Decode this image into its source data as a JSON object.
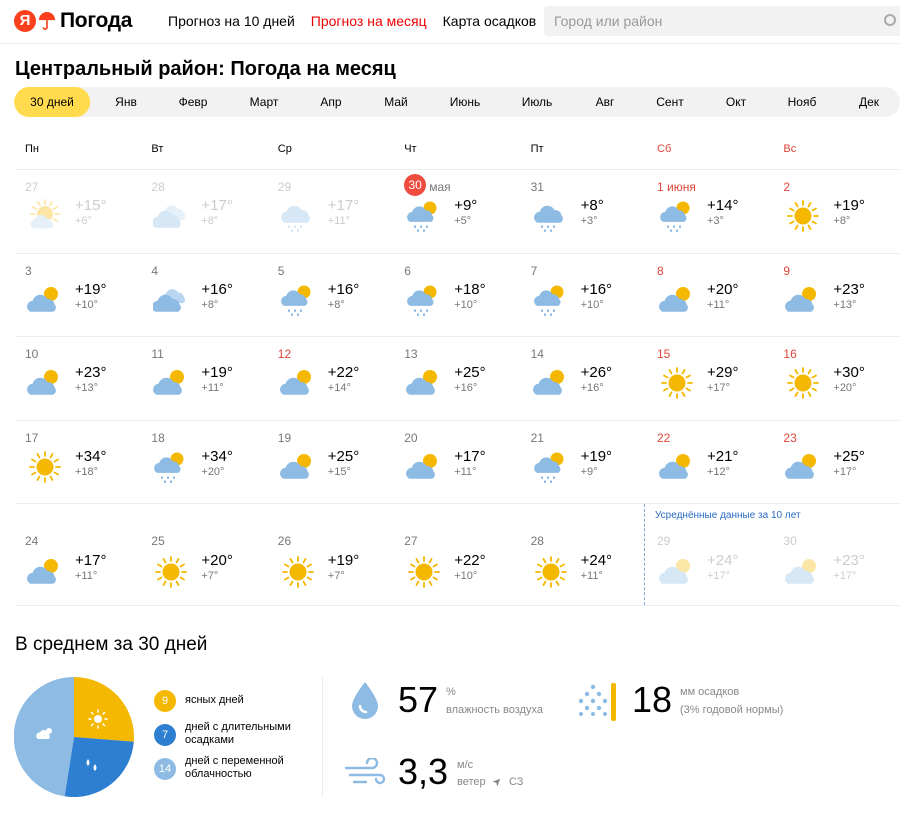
{
  "header": {
    "logo_letter": "Я",
    "logo_text": "Погода",
    "nav": [
      {
        "label": "Прогноз на 10 дней",
        "active": false
      },
      {
        "label": "Прогноз на месяц",
        "active": true
      },
      {
        "label": "Карта осадков",
        "active": false
      }
    ],
    "search_placeholder": "Город или район"
  },
  "title": "Центральный район: Погода на месяц",
  "tabs": [
    "30 дней",
    "Янв",
    "Февр",
    "Март",
    "Апр",
    "Май",
    "Июнь",
    "Июль",
    "Авг",
    "Сент",
    "Окт",
    "Нояб",
    "Дек"
  ],
  "active_tab": 0,
  "weekdays": [
    "Пн",
    "Вт",
    "Ср",
    "Чт",
    "Пт",
    "Сб",
    "Вс"
  ],
  "calendar": {
    "average_note": "Усреднённые данные за 10 лет",
    "weeks": [
      [
        {
          "date": "27",
          "icon": "partly-sunny",
          "max": "+15°",
          "min": "+6°",
          "state": "past"
        },
        {
          "date": "28",
          "icon": "cloudy",
          "max": "+17°",
          "min": "+8°",
          "state": "past"
        },
        {
          "date": "29",
          "icon": "cloud-rain",
          "max": "+17°",
          "min": "+11°",
          "state": "past"
        },
        {
          "date": "30",
          "date_suffix": "мая",
          "today": true,
          "icon": "sun-cloud-rain",
          "max": "+9°",
          "min": "+5°"
        },
        {
          "date": "31",
          "icon": "cloud-rain",
          "max": "+8°",
          "min": "+3°"
        },
        {
          "date": "1 июня",
          "weekend": true,
          "icon": "sun-cloud-rain",
          "max": "+14°",
          "min": "+3°"
        },
        {
          "date": "2",
          "weekend": true,
          "icon": "sun",
          "max": "+19°",
          "min": "+8°"
        }
      ],
      [
        {
          "date": "3",
          "icon": "sun-cloud",
          "max": "+19°",
          "min": "+10°"
        },
        {
          "date": "4",
          "icon": "cloudy-sun",
          "max": "+16°",
          "min": "+8°"
        },
        {
          "date": "5",
          "icon": "sun-cloud-rain",
          "max": "+16°",
          "min": "+8°"
        },
        {
          "date": "6",
          "icon": "sun-cloud-rain",
          "max": "+18°",
          "min": "+10°"
        },
        {
          "date": "7",
          "icon": "sun-cloud-rain",
          "max": "+16°",
          "min": "+10°"
        },
        {
          "date": "8",
          "weekend": true,
          "icon": "sun-cloud",
          "max": "+20°",
          "min": "+11°"
        },
        {
          "date": "9",
          "weekend": true,
          "icon": "sun-cloud",
          "max": "+23°",
          "min": "+13°"
        }
      ],
      [
        {
          "date": "10",
          "icon": "sun-cloud",
          "max": "+23°",
          "min": "+13°"
        },
        {
          "date": "11",
          "icon": "sun-cloud",
          "max": "+19°",
          "min": "+11°"
        },
        {
          "date": "12",
          "weekend": true,
          "icon": "sun-cloud",
          "max": "+22°",
          "min": "+14°"
        },
        {
          "date": "13",
          "icon": "sun-cloud",
          "max": "+25°",
          "min": "+16°"
        },
        {
          "date": "14",
          "icon": "sun-cloud",
          "max": "+26°",
          "min": "+16°"
        },
        {
          "date": "15",
          "weekend": true,
          "icon": "sun",
          "max": "+29°",
          "min": "+17°"
        },
        {
          "date": "16",
          "weekend": true,
          "icon": "sun",
          "max": "+30°",
          "min": "+20°"
        }
      ],
      [
        {
          "date": "17",
          "icon": "sun",
          "max": "+34°",
          "min": "+18°"
        },
        {
          "date": "18",
          "icon": "sun-cloud-rain",
          "max": "+34°",
          "min": "+20°"
        },
        {
          "date": "19",
          "icon": "sun-cloud",
          "max": "+25°",
          "min": "+15°"
        },
        {
          "date": "20",
          "icon": "sun-cloud",
          "max": "+17°",
          "min": "+11°"
        },
        {
          "date": "21",
          "icon": "sun-cloud-rain",
          "max": "+19°",
          "min": "+9°"
        },
        {
          "date": "22",
          "weekend": true,
          "icon": "sun-cloud",
          "max": "+21°",
          "min": "+12°"
        },
        {
          "date": "23",
          "weekend": true,
          "icon": "sun-cloud",
          "max": "+25°",
          "min": "+17°"
        }
      ],
      [
        {
          "date": "24",
          "icon": "sun-cloud",
          "max": "+17°",
          "min": "+11°"
        },
        {
          "date": "25",
          "icon": "sun",
          "max": "+20°",
          "min": "+7°"
        },
        {
          "date": "26",
          "icon": "sun",
          "max": "+19°",
          "min": "+7°"
        },
        {
          "date": "27",
          "icon": "sun",
          "max": "+22°",
          "min": "+10°"
        },
        {
          "date": "28",
          "icon": "sun",
          "max": "+24°",
          "min": "+11°"
        },
        {
          "date": "29",
          "icon": "sun-cloud",
          "max": "+24°",
          "min": "+17°",
          "state": "future"
        },
        {
          "date": "30",
          "icon": "sun-cloud",
          "max": "+23°",
          "min": "+17°",
          "state": "future"
        }
      ]
    ]
  },
  "summary": {
    "title": "В среднем за 30 дней",
    "legend": [
      {
        "count": "9",
        "label_lines": [
          "ясных дней"
        ],
        "color": "#f5b800"
      },
      {
        "count": "7",
        "label_lines": [
          "дней с длительными",
          "осадками"
        ],
        "color": "#2e7fd1"
      },
      {
        "count": "14",
        "label_lines": [
          "дней с переменной",
          "облачностью"
        ],
        "color": "#8dbbe3"
      }
    ],
    "humidity": {
      "value": "57",
      "unit": "%",
      "label": "влажность воздуха"
    },
    "precip": {
      "value": "18",
      "unit": "мм осадков",
      "label": "(3% годовой нормы)"
    },
    "wind": {
      "value": "3,3",
      "unit": "м/с",
      "label": "ветер",
      "direction": "СЗ"
    }
  }
}
